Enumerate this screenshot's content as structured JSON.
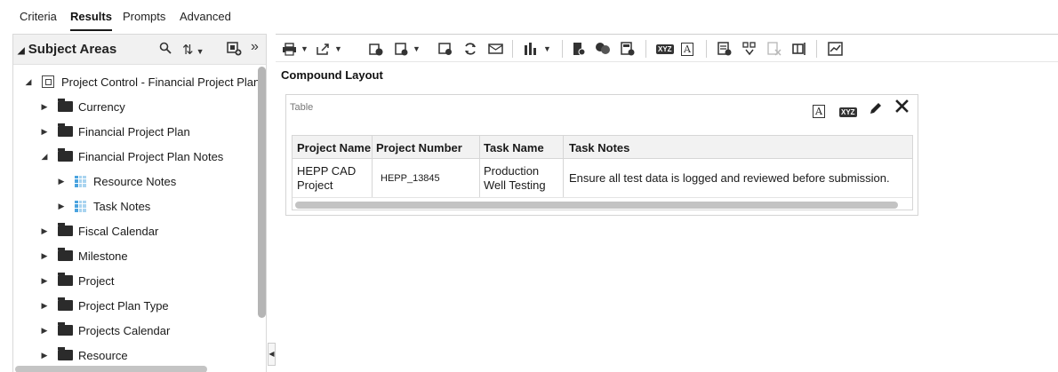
{
  "tabs": [
    {
      "label": "Criteria"
    },
    {
      "label": "Results"
    },
    {
      "label": "Prompts"
    },
    {
      "label": "Advanced"
    }
  ],
  "subject_areas": {
    "title": "Subject Areas",
    "tree": [
      {
        "label": "Project Control - Financial Project Plans",
        "type": "root"
      },
      {
        "label": "Currency",
        "type": "folder"
      },
      {
        "label": "Financial Project Plan",
        "type": "folder"
      },
      {
        "label": "Financial Project Plan Notes",
        "type": "folder-open"
      },
      {
        "label": "Resource Notes",
        "type": "table"
      },
      {
        "label": "Task Notes",
        "type": "table"
      },
      {
        "label": "Fiscal Calendar",
        "type": "folder"
      },
      {
        "label": "Milestone",
        "type": "folder"
      },
      {
        "label": "Project",
        "type": "folder"
      },
      {
        "label": "Project Plan Type",
        "type": "folder"
      },
      {
        "label": "Projects Calendar",
        "type": "folder"
      },
      {
        "label": "Resource",
        "type": "folder"
      }
    ]
  },
  "toolbar": {
    "xyz_label": "XYZ",
    "text_label": "A"
  },
  "compound_layout": {
    "title": "Compound Layout",
    "view_label": "Table",
    "xyz_label": "XYZ",
    "text_label": "A"
  },
  "table": {
    "columns": [
      "Project Name",
      "Project Number",
      "Task Name",
      "Task Notes"
    ],
    "rows": [
      [
        "HEPP CAD Project",
        "HEPP_13845",
        "Production Well Testing",
        "Ensure all test data is logged and reviewed before submission."
      ]
    ]
  }
}
